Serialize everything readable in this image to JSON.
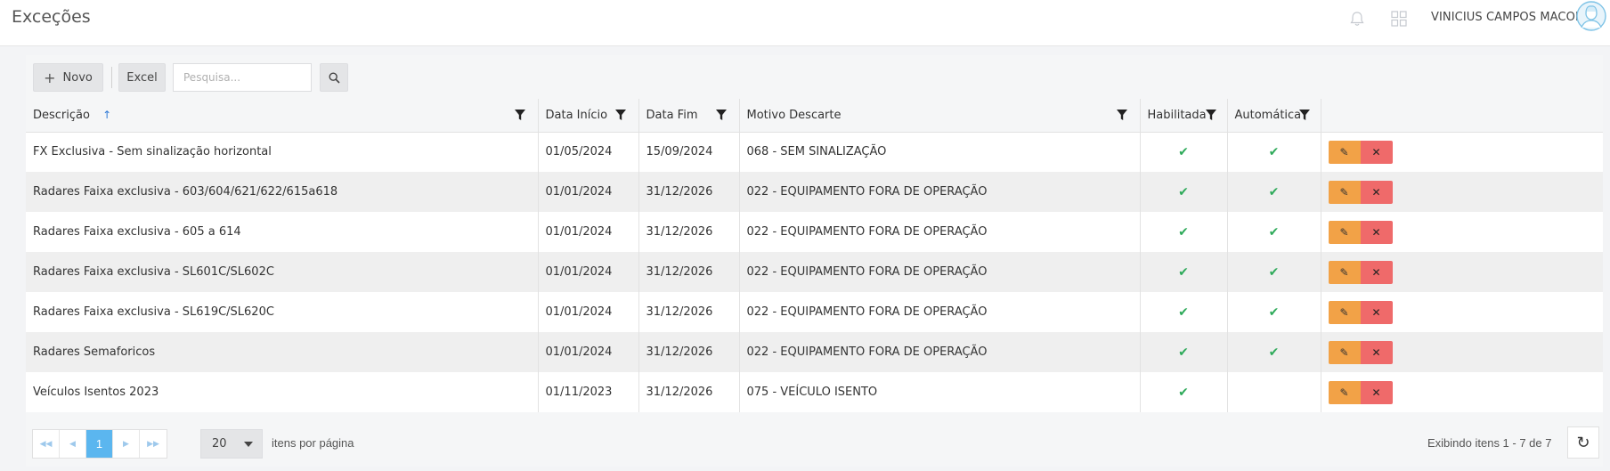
{
  "header": {
    "title": "Exceções",
    "user_name": "VINICIUS CAMPOS MACON",
    "icons": [
      "bell-icon",
      "apps-grid-icon",
      "avatar"
    ]
  },
  "toolbar": {
    "new_label": "Novo",
    "excel_label": "Excel",
    "search_placeholder": "Pesquisa..."
  },
  "table": {
    "columns": [
      "Descrição",
      "Data Início",
      "Data Fim",
      "Motivo Descarte",
      "Habilitada",
      "Automática"
    ],
    "sort_indicator": "↑",
    "rows": [
      {
        "descricao": "FX Exclusiva - Sem sinalização horizontal",
        "inicio": "01/05/2024",
        "fim": "15/09/2024",
        "motivo": "068 - SEM SINALIZAÇÃO",
        "habilitada": true,
        "automatica": true
      },
      {
        "descricao": "Radares Faixa exclusiva - 603/604/621/622/615a618",
        "inicio": "01/01/2024",
        "fim": "31/12/2026",
        "motivo": "022 - EQUIPAMENTO FORA DE OPERAÇÃO",
        "habilitada": true,
        "automatica": true
      },
      {
        "descricao": "Radares Faixa exclusiva - 605 a 614",
        "inicio": "01/01/2024",
        "fim": "31/12/2026",
        "motivo": "022 - EQUIPAMENTO FORA DE OPERAÇÃO",
        "habilitada": true,
        "automatica": true
      },
      {
        "descricao": "Radares Faixa exclusiva - SL601C/SL602C",
        "inicio": "01/01/2024",
        "fim": "31/12/2026",
        "motivo": "022 - EQUIPAMENTO FORA DE OPERAÇÃO",
        "habilitada": true,
        "automatica": true
      },
      {
        "descricao": "Radares Faixa exclusiva - SL619C/SL620C",
        "inicio": "01/01/2024",
        "fim": "31/12/2026",
        "motivo": "022 - EQUIPAMENTO FORA DE OPERAÇÃO",
        "habilitada": true,
        "automatica": true
      },
      {
        "descricao": "Radares Semaforicos",
        "inicio": "01/01/2024",
        "fim": "31/12/2026",
        "motivo": "022 - EQUIPAMENTO FORA DE OPERAÇÃO",
        "habilitada": true,
        "automatica": true
      },
      {
        "descricao": "Veículos Isentos 2023",
        "inicio": "01/11/2023",
        "fim": "31/12/2026",
        "motivo": "075 - VEÍCULO ISENTO",
        "habilitada": true,
        "automatica": false
      }
    ]
  },
  "pagination": {
    "current_page": "1",
    "page_size": "20",
    "per_page_label": "itens por página",
    "showing_text": "Exibindo itens 1 - 7 de 7"
  },
  "colors": {
    "edit_button": "#f2a247",
    "delete_button": "#ef6a6a",
    "check": "#2eaa5a",
    "active_page": "#5bb6ef",
    "sort_arrow": "#2f7ad6"
  }
}
